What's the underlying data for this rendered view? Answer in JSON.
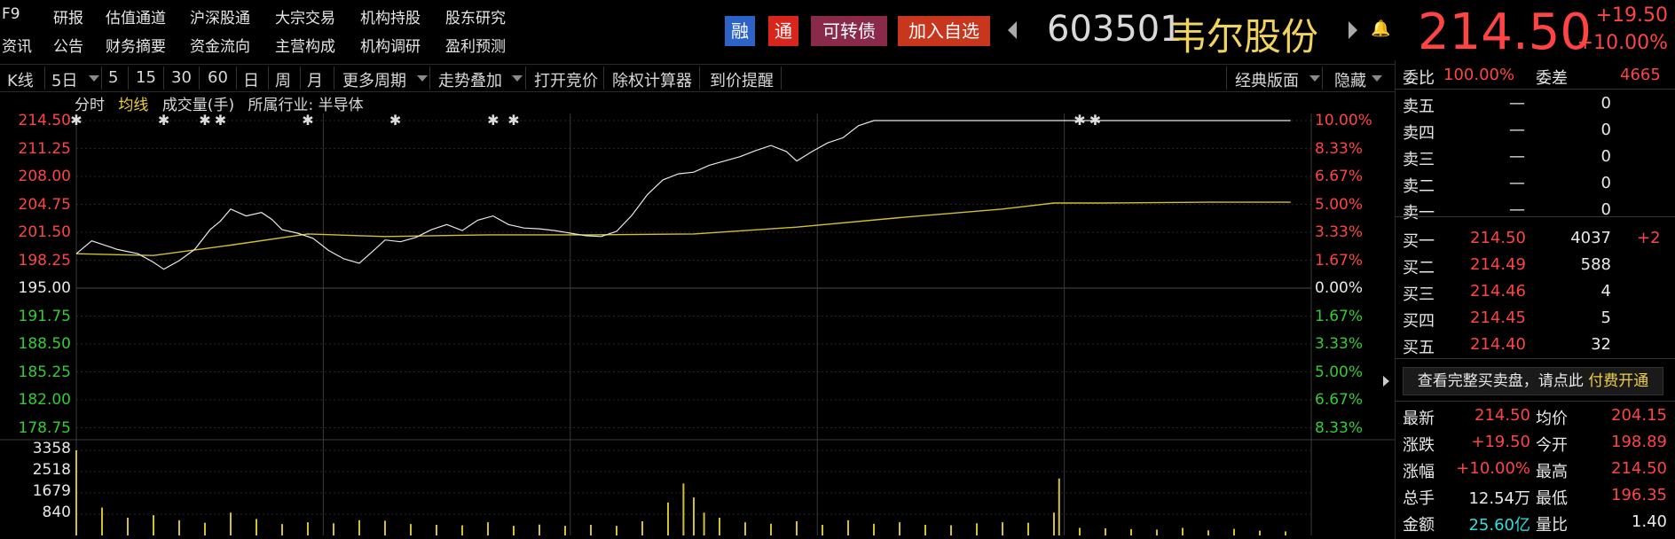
{
  "nav": {
    "row1": [
      "F9",
      "研报",
      "估值通道",
      "沪深股通",
      "大宗交易",
      "机构持股",
      "股东研究"
    ],
    "row2": [
      "资讯",
      "公告",
      "财务摘要",
      "资金流向",
      "主营构成",
      "机构调研",
      "盈利预测"
    ]
  },
  "badges": {
    "rong": "融",
    "tong": "通",
    "convertible": "可转债",
    "add_watch": "加入自选"
  },
  "badge_colors": {
    "rong": "#2b63c7",
    "tong": "#d9261c",
    "convertible": "#8a2a4a",
    "add_watch": "#c9361e"
  },
  "stock": {
    "code": "603501",
    "name": "韦尔股份",
    "price": "214.50",
    "change": "+19.50",
    "change_pct": "+10.00%"
  },
  "toolbar": {
    "kline": "K线",
    "days": "5日",
    "p5": "5",
    "p15": "15",
    "p30": "30",
    "p60": "60",
    "day": "日",
    "week": "周",
    "month": "月",
    "more": "更多周期",
    "overlay": "走势叠加",
    "auction": "打开竞价",
    "calc": "除权计算器",
    "alert": "到价提醒",
    "layout": "经典版面",
    "hide": "隐藏"
  },
  "subheader": {
    "timeshare": "分时",
    "avg_line": "均线",
    "volume": "成交量(手)",
    "industry_label": "所属行业:",
    "industry": "半导体"
  },
  "y_left": [
    "214.50",
    "211.25",
    "208.00",
    "204.75",
    "201.50",
    "198.25",
    "195.00",
    "191.75",
    "188.50",
    "185.25",
    "182.00",
    "178.75"
  ],
  "y_right": [
    "10.00%",
    "8.33%",
    "6.67%",
    "5.00%",
    "3.33%",
    "1.67%",
    "0.00%",
    "1.67%",
    "3.33%",
    "5.00%",
    "6.67%",
    "8.33%"
  ],
  "vol_labels": [
    "3358",
    "2518",
    "1679",
    "840"
  ],
  "chart_data": {
    "type": "line",
    "title": "",
    "xlabel": "",
    "ylabel": "",
    "ylim": [
      178.75,
      214.5
    ],
    "y_ticks": [
      214.5,
      211.25,
      208.0,
      204.75,
      201.5,
      198.25,
      195.0,
      191.75,
      188.5,
      185.25,
      182.0,
      178.75
    ],
    "pct_ticks": [
      "10.00%",
      "8.33%",
      "6.67%",
      "5.00%",
      "3.33%",
      "1.67%",
      "0.00%",
      "1.67%",
      "3.33%",
      "5.00%",
      "6.67%",
      "8.33%"
    ],
    "x_range": [
      0,
      240
    ],
    "prev_close": 195.0,
    "series": [
      {
        "type": "line",
        "color": "#e8e8e8",
        "x": [
          0,
          3,
          8,
          12,
          15,
          17,
          20,
          23,
          26,
          28,
          30,
          33,
          36,
          38,
          40,
          43,
          46,
          49,
          52,
          55,
          58,
          60,
          63,
          66,
          69,
          72,
          75,
          78,
          81,
          84,
          87,
          90,
          93,
          96,
          99,
          102,
          105,
          108,
          111,
          114,
          117,
          120,
          123,
          126,
          129,
          132,
          135,
          138,
          140,
          143,
          146,
          149,
          152,
          155,
          158,
          161,
          164,
          167,
          170,
          173,
          176,
          179,
          182,
          185,
          188,
          191,
          194,
          197,
          200,
          203,
          206,
          209,
          212,
          215,
          218,
          221,
          224,
          227,
          230,
          233,
          236
        ],
        "y": [
          199.0,
          200.5,
          199.5,
          199.0,
          198.0,
          197.2,
          198.2,
          199.5,
          201.8,
          202.8,
          204.2,
          203.4,
          203.8,
          203.0,
          201.8,
          201.4,
          200.8,
          199.4,
          198.4,
          197.9,
          199.5,
          200.6,
          200.4,
          200.9,
          201.8,
          202.4,
          201.7,
          202.9,
          203.4,
          202.4,
          202.0,
          201.9,
          201.7,
          201.4,
          201.1,
          201.0,
          201.6,
          203.5,
          205.9,
          207.6,
          208.3,
          208.5,
          209.3,
          209.8,
          210.3,
          211.0,
          211.6,
          210.9,
          209.8,
          210.9,
          211.9,
          212.5,
          213.9,
          214.5,
          214.5,
          214.5,
          214.5,
          214.5,
          214.5,
          214.5,
          214.5,
          214.5,
          214.5,
          214.5,
          214.5,
          214.5,
          214.5,
          214.5,
          214.5,
          214.5,
          214.5,
          214.5,
          214.5,
          214.5,
          214.5,
          214.5,
          214.5,
          214.5,
          214.5,
          214.5,
          214.5
        ]
      },
      {
        "type": "line",
        "color": "#d2c030",
        "x": [
          0,
          15,
          30,
          45,
          60,
          80,
          100,
          120,
          140,
          160,
          180,
          190,
          200,
          220,
          236
        ],
        "y": [
          199.0,
          198.8,
          200.0,
          201.3,
          201.0,
          201.2,
          201.2,
          201.3,
          202.1,
          203.2,
          204.2,
          204.9,
          204.9,
          205.0,
          205.0
        ]
      }
    ],
    "volume": {
      "ylim": [
        0,
        3358
      ],
      "x": [
        0,
        5,
        10,
        15,
        20,
        25,
        30,
        35,
        40,
        45,
        50,
        55,
        60,
        65,
        70,
        75,
        80,
        85,
        90,
        95,
        100,
        105,
        110,
        115,
        118,
        120,
        122,
        125,
        130,
        135,
        140,
        145,
        150,
        155,
        160,
        165,
        170,
        175,
        180,
        185,
        190,
        191,
        195,
        200,
        205,
        210,
        215,
        220,
        225,
        230,
        235
      ],
      "values": [
        3358,
        1100,
        700,
        800,
        600,
        500,
        900,
        650,
        450,
        520,
        480,
        600,
        580,
        450,
        420,
        400,
        520,
        380,
        430,
        380,
        420,
        380,
        560,
        1300,
        2050,
        1500,
        900,
        700,
        520,
        460,
        560,
        420,
        600,
        460,
        520,
        420,
        400,
        480,
        520,
        500,
        900,
        2250,
        300,
        280,
        250,
        230,
        300,
        200,
        260,
        190,
        160
      ]
    },
    "markers": [
      0,
      17,
      25,
      28,
      45,
      62,
      81,
      85,
      195,
      198
    ]
  },
  "panel": {
    "webi_label": "委比",
    "webi_value": "100.00%",
    "weicha_label": "委差",
    "weicha_value": "4665",
    "sells": [
      {
        "label": "卖五",
        "price": "—",
        "vol": "0"
      },
      {
        "label": "卖四",
        "price": "—",
        "vol": "0"
      },
      {
        "label": "卖三",
        "price": "—",
        "vol": "0"
      },
      {
        "label": "卖二",
        "price": "—",
        "vol": "0"
      },
      {
        "label": "卖一",
        "price": "—",
        "vol": "0"
      }
    ],
    "buys": [
      {
        "label": "买一",
        "price": "214.50",
        "vol": "4037",
        "delta": "+2"
      },
      {
        "label": "买二",
        "price": "214.49",
        "vol": "588",
        "delta": ""
      },
      {
        "label": "买三",
        "price": "214.46",
        "vol": "4",
        "delta": ""
      },
      {
        "label": "买四",
        "price": "214.45",
        "vol": "5",
        "delta": ""
      },
      {
        "label": "买五",
        "price": "214.40",
        "vol": "32",
        "delta": ""
      }
    ],
    "promo_text": "查看完整买卖盘，请点此",
    "promo_link": "付费开通",
    "stats": [
      {
        "l1": "最新",
        "v1": "214.50",
        "c1": "red",
        "l2": "均价",
        "v2": "204.15",
        "c2": "red"
      },
      {
        "l1": "涨跌",
        "v1": "+19.50",
        "c1": "red",
        "l2": "今开",
        "v2": "198.89",
        "c2": "red"
      },
      {
        "l1": "涨幅",
        "v1": "+10.00%",
        "c1": "red",
        "l2": "最高",
        "v2": "214.50",
        "c2": "red"
      },
      {
        "l1": "总手",
        "v1": "12.54万",
        "c1": "white",
        "l2": "最低",
        "v2": "196.35",
        "c2": "red"
      },
      {
        "l1": "金额",
        "v1": "25.60亿",
        "c1": "cyan",
        "l2": "量比",
        "v2": "1.40",
        "c2": "white"
      }
    ]
  }
}
